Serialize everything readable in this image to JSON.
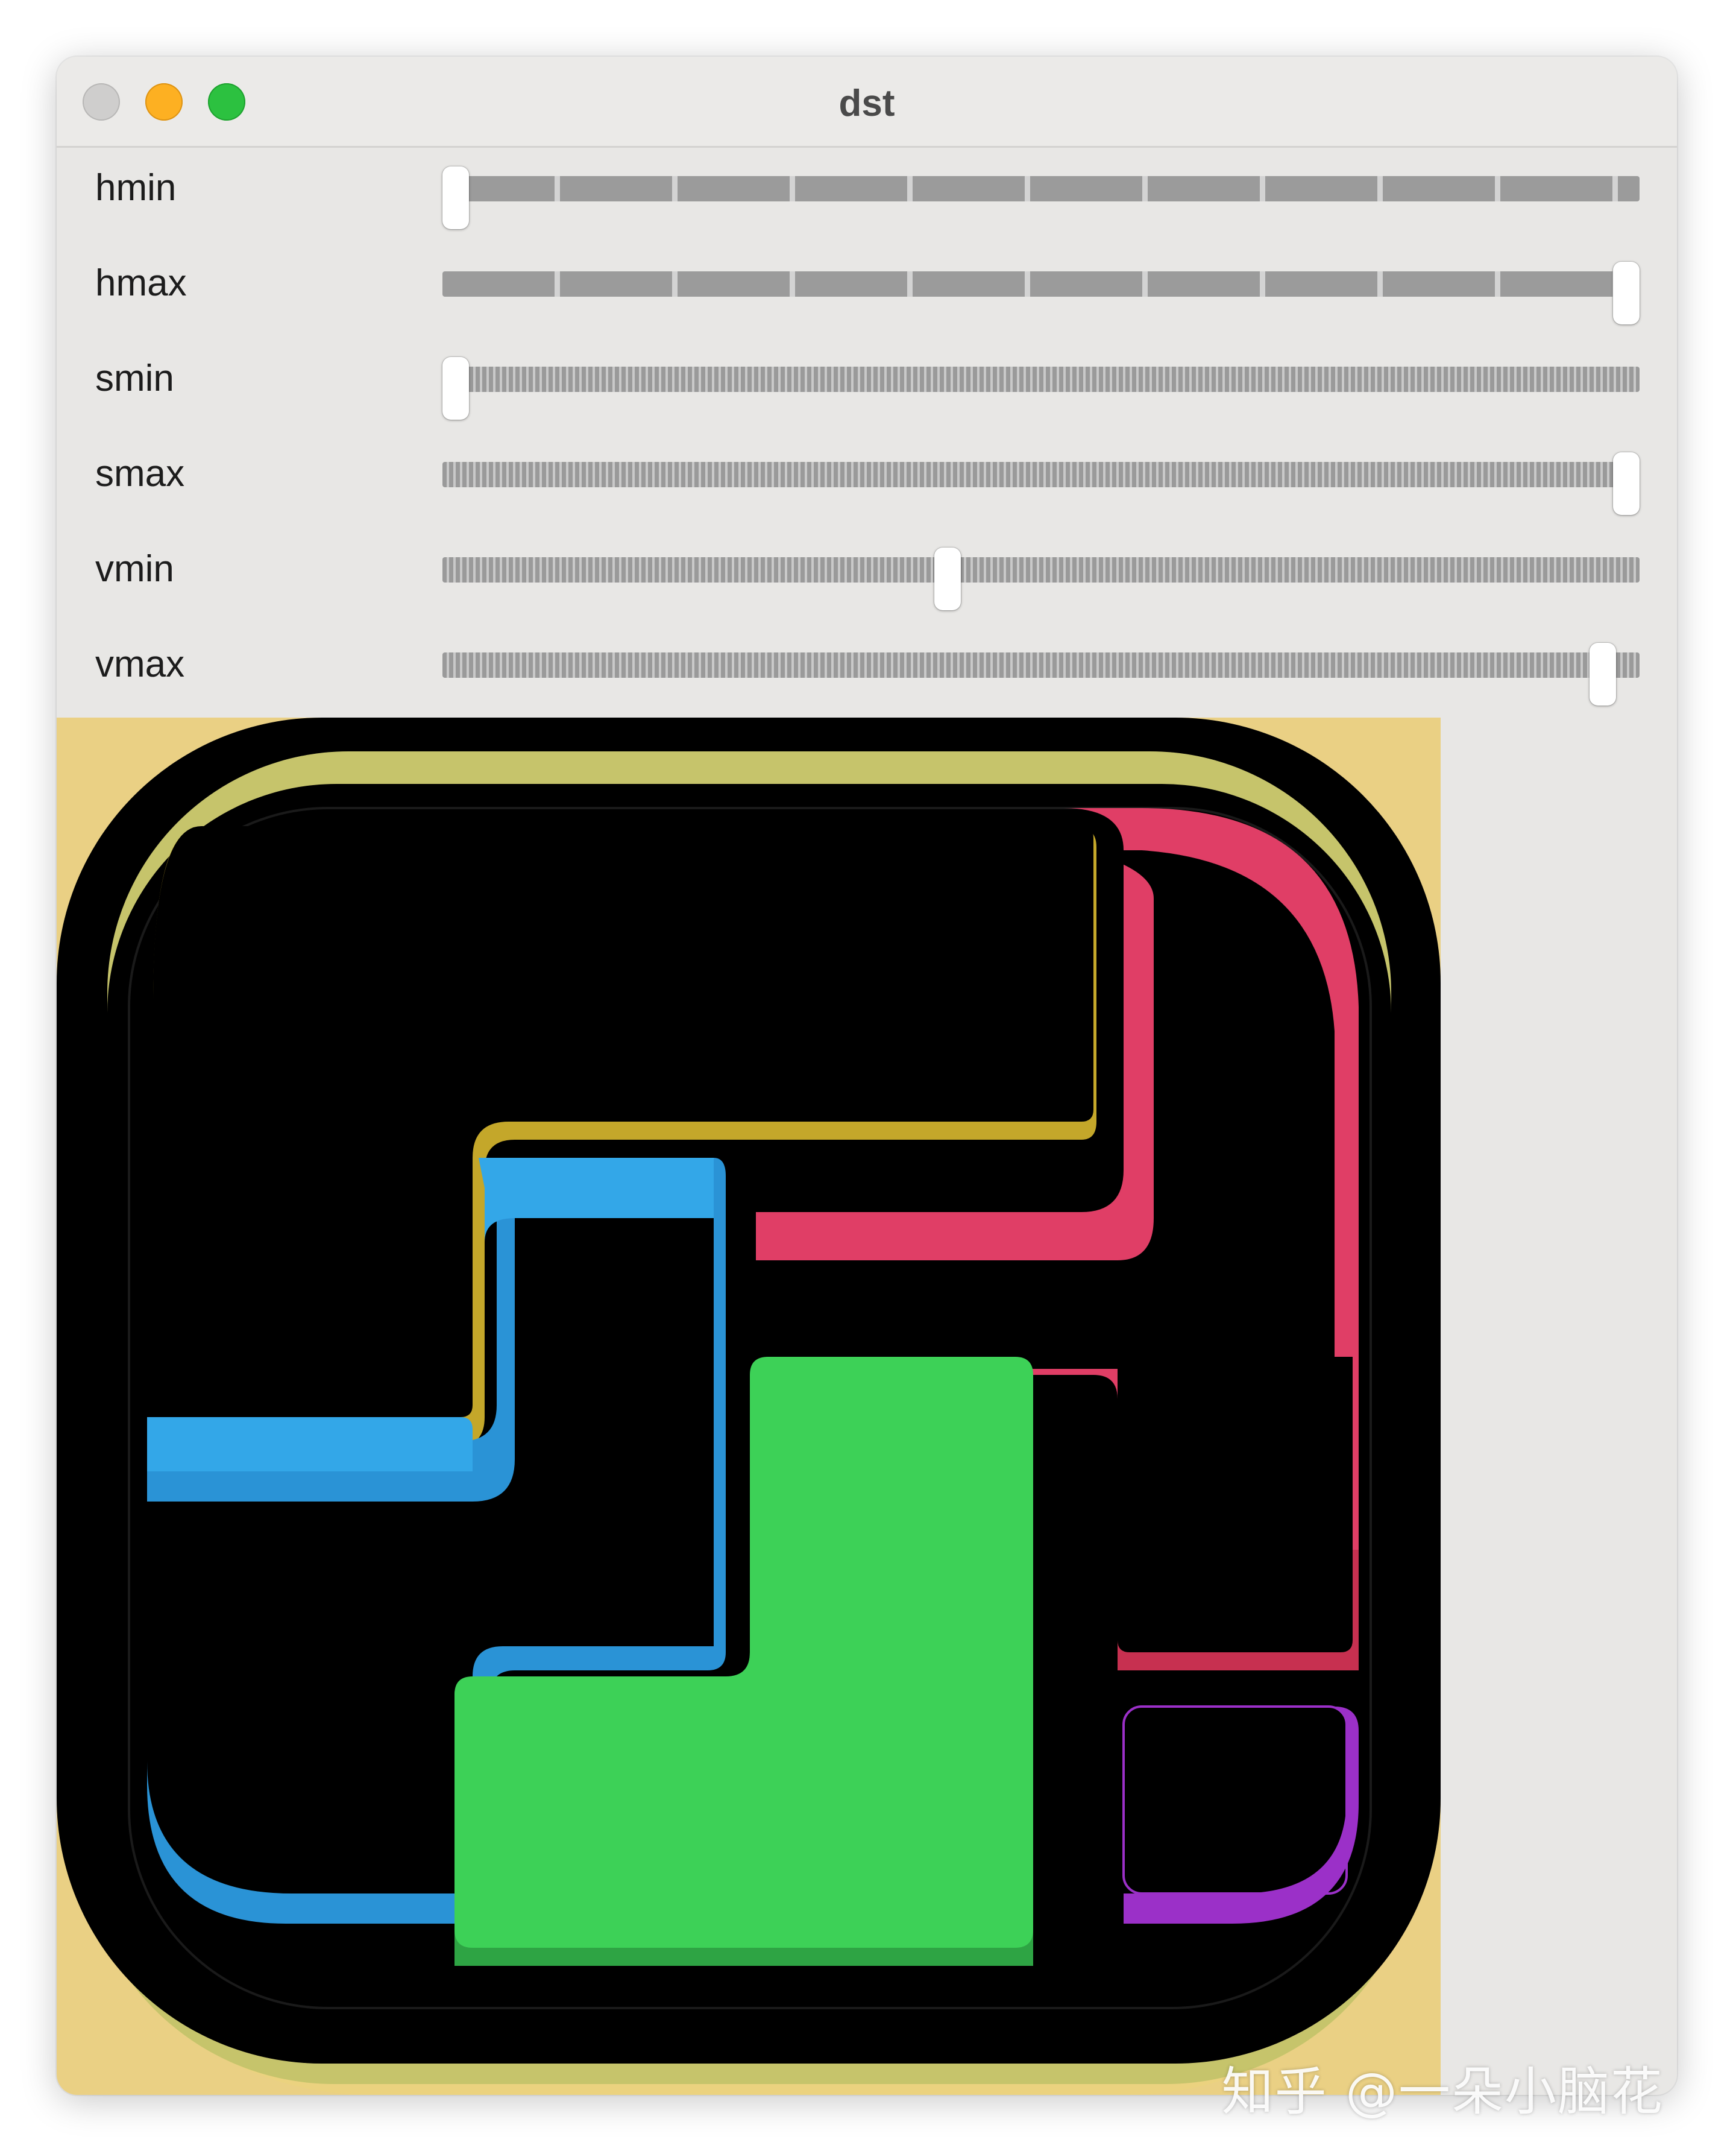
{
  "window": {
    "title": "dst"
  },
  "sliders": [
    {
      "label": "hmin",
      "value": 0.0,
      "track": "coarse"
    },
    {
      "label": "hmax",
      "value": 1.0,
      "track": "coarse"
    },
    {
      "label": "smin",
      "value": 0.0,
      "track": "fine"
    },
    {
      "label": "smax",
      "value": 1.0,
      "track": "fine"
    },
    {
      "label": "vmin",
      "value": 0.42,
      "track": "fine"
    },
    {
      "label": "vmax",
      "value": 0.98,
      "track": "fine"
    }
  ],
  "image": {
    "colors": {
      "background": "#ead084",
      "olive": "#c6c46b",
      "black": "#000000",
      "yellow": "#c4a72a",
      "pink": "#e03e66",
      "blue": "#2a93d6",
      "light_blue": "#33a7e8",
      "green": "#3dd157",
      "dark_green": "#2ea444",
      "red": "#c73050",
      "purple": "#9b30c8"
    }
  },
  "watermark": {
    "text": "知乎 @一朵小脑花"
  }
}
